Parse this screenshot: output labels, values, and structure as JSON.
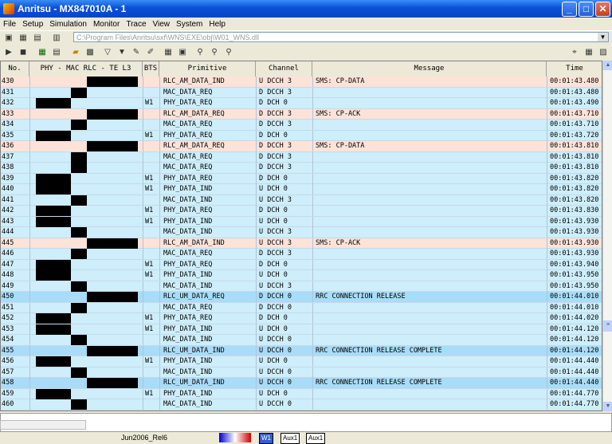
{
  "window": {
    "title": "Anritsu - MX847010A - 1"
  },
  "menu": [
    "File",
    "Setup",
    "Simulation",
    "Monitor",
    "Trace",
    "View",
    "System",
    "Help"
  ],
  "path": "C:\\Program Files\\Anritsu\\sxf\\WNS\\EXE\\obj\\W01_WNS.dll",
  "columns": {
    "no": "No.",
    "layers": "PHY  -  MAC RLC  -  TE  L3",
    "bts": "BTS",
    "primitive": "Primitive",
    "channel": "Channel",
    "message": "Message",
    "time": "Time"
  },
  "rows": [
    {
      "no": "430",
      "bts": "",
      "prim": "RLC_AM_DATA_IND",
      "chan": "U DCCH 3",
      "msg": "SMS: CP-DATA",
      "time": "00:01:43.480",
      "hl": "pink",
      "arr": "rlc-r"
    },
    {
      "no": "431",
      "bts": "",
      "prim": "MAC_DATA_REQ",
      "chan": "D DCCH 3",
      "msg": "",
      "time": "00:01:43.480",
      "hl": "",
      "arr": "mac-l"
    },
    {
      "no": "432",
      "bts": "W1",
      "prim": "PHY_DATA_REQ",
      "chan": "D DCH 0",
      "msg": "",
      "time": "00:01:43.490",
      "hl": "",
      "arr": "phy-l"
    },
    {
      "no": "433",
      "bts": "",
      "prim": "RLC_AM_DATA_REQ",
      "chan": "D DCCH 3",
      "msg": "SMS: CP-ACK",
      "time": "00:01:43.710",
      "hl": "pink",
      "arr": "rlc-l"
    },
    {
      "no": "434",
      "bts": "",
      "prim": "MAC_DATA_REQ",
      "chan": "D DCCH 3",
      "msg": "",
      "time": "00:01:43.710",
      "hl": "",
      "arr": "mac-l"
    },
    {
      "no": "435",
      "bts": "W1",
      "prim": "PHY_DATA_REQ",
      "chan": "D DCH 0",
      "msg": "",
      "time": "00:01:43.720",
      "hl": "",
      "arr": "phy-l"
    },
    {
      "no": "436",
      "bts": "",
      "prim": "RLC_AM_DATA_REQ",
      "chan": "D DCCH 3",
      "msg": "SMS: CP-DATA",
      "time": "00:01:43.810",
      "hl": "pink",
      "arr": "rlc-l"
    },
    {
      "no": "437",
      "bts": "",
      "prim": "MAC_DATA_REQ",
      "chan": "D DCCH 3",
      "msg": "",
      "time": "00:01:43.810",
      "hl": "",
      "arr": "mac-l"
    },
    {
      "no": "438",
      "bts": "",
      "prim": "MAC_DATA_REQ",
      "chan": "D DCCH 3",
      "msg": "",
      "time": "00:01:43.810",
      "hl": "",
      "arr": "mac-l"
    },
    {
      "no": "439",
      "bts": "W1",
      "prim": "PHY_DATA_REQ",
      "chan": "D DCH 0",
      "msg": "",
      "time": "00:01:43.820",
      "hl": "",
      "arr": "phy-l"
    },
    {
      "no": "440",
      "bts": "W1",
      "prim": "PHY_DATA_IND",
      "chan": "U DCH 0",
      "msg": "",
      "time": "00:01:43.820",
      "hl": "",
      "arr": "phy-r"
    },
    {
      "no": "441",
      "bts": "",
      "prim": "MAC_DATA_IND",
      "chan": "U DCCH 3",
      "msg": "",
      "time": "00:01:43.820",
      "hl": "",
      "arr": "mac-r"
    },
    {
      "no": "442",
      "bts": "W1",
      "prim": "PHY_DATA_REQ",
      "chan": "D DCH 0",
      "msg": "",
      "time": "00:01:43.830",
      "hl": "",
      "arr": "phy-l"
    },
    {
      "no": "443",
      "bts": "W1",
      "prim": "PHY_DATA_IND",
      "chan": "U DCH 0",
      "msg": "",
      "time": "00:01:43.930",
      "hl": "",
      "arr": "phy-r"
    },
    {
      "no": "444",
      "bts": "",
      "prim": "MAC_DATA_IND",
      "chan": "U DCCH 3",
      "msg": "",
      "time": "00:01:43.930",
      "hl": "",
      "arr": "mac-r"
    },
    {
      "no": "445",
      "bts": "",
      "prim": "RLC_AM_DATA_IND",
      "chan": "U DCCH 3",
      "msg": "SMS: CP-ACK",
      "time": "00:01:43.930",
      "hl": "pink",
      "arr": "rlc-r"
    },
    {
      "no": "446",
      "bts": "",
      "prim": "MAC_DATA_REQ",
      "chan": "D DCCH 3",
      "msg": "",
      "time": "00:01:43.930",
      "hl": "",
      "arr": "mac-l"
    },
    {
      "no": "447",
      "bts": "W1",
      "prim": "PHY_DATA_REQ",
      "chan": "D DCH 0",
      "msg": "",
      "time": "00:01:43.940",
      "hl": "",
      "arr": "phy-l"
    },
    {
      "no": "448",
      "bts": "W1",
      "prim": "PHY_DATA_IND",
      "chan": "U DCH 0",
      "msg": "",
      "time": "00:01:43.950",
      "hl": "",
      "arr": "phy-r"
    },
    {
      "no": "449",
      "bts": "",
      "prim": "MAC_DATA_IND",
      "chan": "U DCCH 3",
      "msg": "",
      "time": "00:01:43.950",
      "hl": "",
      "arr": "mac-r"
    },
    {
      "no": "450",
      "bts": "",
      "prim": "RLC_UM_DATA_REQ",
      "chan": "D DCCH 0",
      "msg": "RRC CONNECTION RELEASE",
      "time": "00:01:44.010",
      "hl": "blue",
      "arr": "rlc-l"
    },
    {
      "no": "451",
      "bts": "",
      "prim": "MAC_DATA_REQ",
      "chan": "D DCCH 0",
      "msg": "",
      "time": "00:01:44.010",
      "hl": "",
      "arr": "mac-l"
    },
    {
      "no": "452",
      "bts": "W1",
      "prim": "PHY_DATA_REQ",
      "chan": "D DCH 0",
      "msg": "",
      "time": "00:01:44.020",
      "hl": "",
      "arr": "phy-l"
    },
    {
      "no": "453",
      "bts": "W1",
      "prim": "PHY_DATA_IND",
      "chan": "U DCH 0",
      "msg": "",
      "time": "00:01:44.120",
      "hl": "",
      "arr": "phy-r"
    },
    {
      "no": "454",
      "bts": "",
      "prim": "MAC_DATA_IND",
      "chan": "U DCCH 0",
      "msg": "",
      "time": "00:01:44.120",
      "hl": "",
      "arr": "mac-r"
    },
    {
      "no": "455",
      "bts": "",
      "prim": "RLC_UM_DATA_IND",
      "chan": "U DCCH 0",
      "msg": "RRC CONNECTION RELEASE COMPLETE",
      "time": "00:01:44.120",
      "hl": "blue",
      "arr": "rlc-r"
    },
    {
      "no": "456",
      "bts": "W1",
      "prim": "PHY_DATA_IND",
      "chan": "U DCH 0",
      "msg": "",
      "time": "00:01:44.440",
      "hl": "",
      "arr": "phy-r"
    },
    {
      "no": "457",
      "bts": "",
      "prim": "MAC_DATA_IND",
      "chan": "U DCCH 0",
      "msg": "",
      "time": "00:01:44.440",
      "hl": "",
      "arr": "mac-r"
    },
    {
      "no": "458",
      "bts": "",
      "prim": "RLC_UM_DATA_IND",
      "chan": "U DCCH 0",
      "msg": "RRC CONNECTION RELEASE COMPLETE",
      "time": "00:01:44.440",
      "hl": "blue",
      "arr": "rlc-r"
    },
    {
      "no": "459",
      "bts": "W1",
      "prim": "PHY_DATA_IND",
      "chan": "U DCH 0",
      "msg": "",
      "time": "00:01:44.770",
      "hl": "",
      "arr": "phy-r"
    },
    {
      "no": "460",
      "bts": "",
      "prim": "MAC_DATA_IND",
      "chan": "U DCCH 0",
      "msg": "",
      "time": "00:01:44.770",
      "hl": "",
      "arr": "mac-r"
    }
  ],
  "colors": {
    "pink": "#fde2d8",
    "blue": "#a8dcf8",
    "plain": "#cdeefa"
  },
  "status": {
    "release": "Jun2006_Rel6",
    "w1": "W1",
    "aux1a": "Aux1",
    "aux1b": "Aux1"
  }
}
